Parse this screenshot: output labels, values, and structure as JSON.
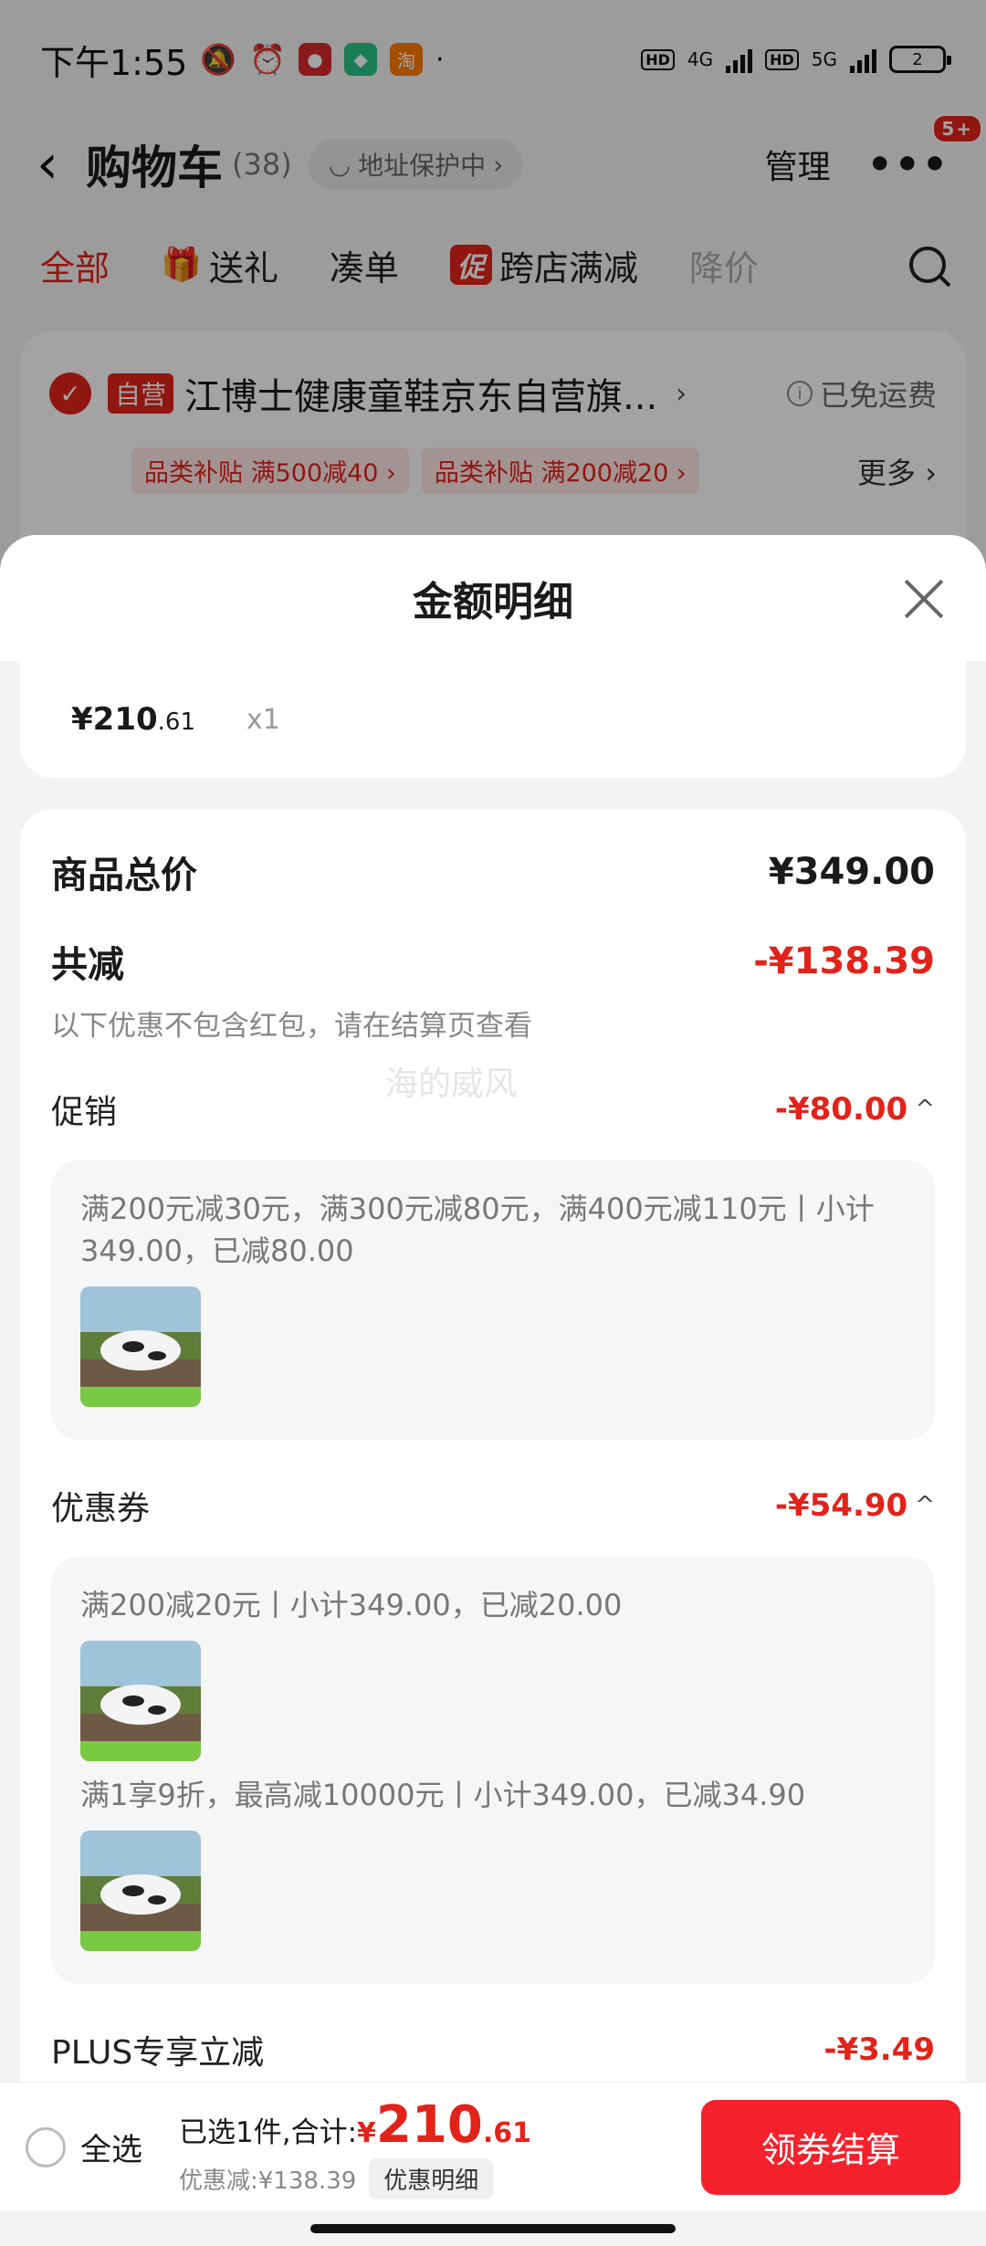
{
  "status_bar": {
    "time": "下午1:55",
    "net1": "4G",
    "net2": "5G",
    "battery": "2",
    "hd": "HD"
  },
  "nav": {
    "title": "购物车",
    "count": "(38)",
    "address_protect": "地址保护中",
    "manage": "管理",
    "badge": "5+"
  },
  "tabs": [
    {
      "label": "全部"
    },
    {
      "label": "送礼"
    },
    {
      "label": "凑单"
    },
    {
      "label": "跨店满减",
      "tag": "促"
    },
    {
      "label": "降价"
    }
  ],
  "store": {
    "self_tag": "自营",
    "name": "江博士健康童鞋京东自营旗...",
    "free_shipping": "已免运费",
    "coupons": [
      "品类补贴 满500减40 ›",
      "品类补贴 满200减20 ›"
    ],
    "more": "更多 ›"
  },
  "sheet": {
    "title": "金额明细",
    "item": {
      "price_main": "¥210",
      "price_cents": ".61",
      "qty": "x1"
    },
    "total_label": "商品总价",
    "total_value": "¥349.00",
    "discount_label": "共减",
    "discount_value": "-¥138.39",
    "discount_note": "以下优惠不包含红包，请在结算页查看",
    "watermark": "海的威风",
    "promo": {
      "label": "促销",
      "value": "-¥80.00",
      "rule": "满200元减30元，满300元减80元，满400元减110元丨小计349.00，已减80.00"
    },
    "coupon": {
      "label": "优惠券",
      "value": "-¥54.90",
      "rule1": "满200减20元丨小计349.00，已减20.00",
      "rule2": "满1享9折，最高减10000元丨小计349.00，已减34.90"
    },
    "plus": {
      "label": "PLUS专享立减",
      "value": "-¥3.49"
    }
  },
  "bottom": {
    "select_all": "全选",
    "selected_text": "已选1件,合计:",
    "currency": "¥",
    "total_main": "210",
    "total_cents": ".61",
    "discount_text": "优惠减:¥138.39",
    "detail_button": "优惠明细",
    "checkout": "领券结算"
  },
  "colors": {
    "accent": "#e2231a",
    "checkout": "#f5222d"
  }
}
